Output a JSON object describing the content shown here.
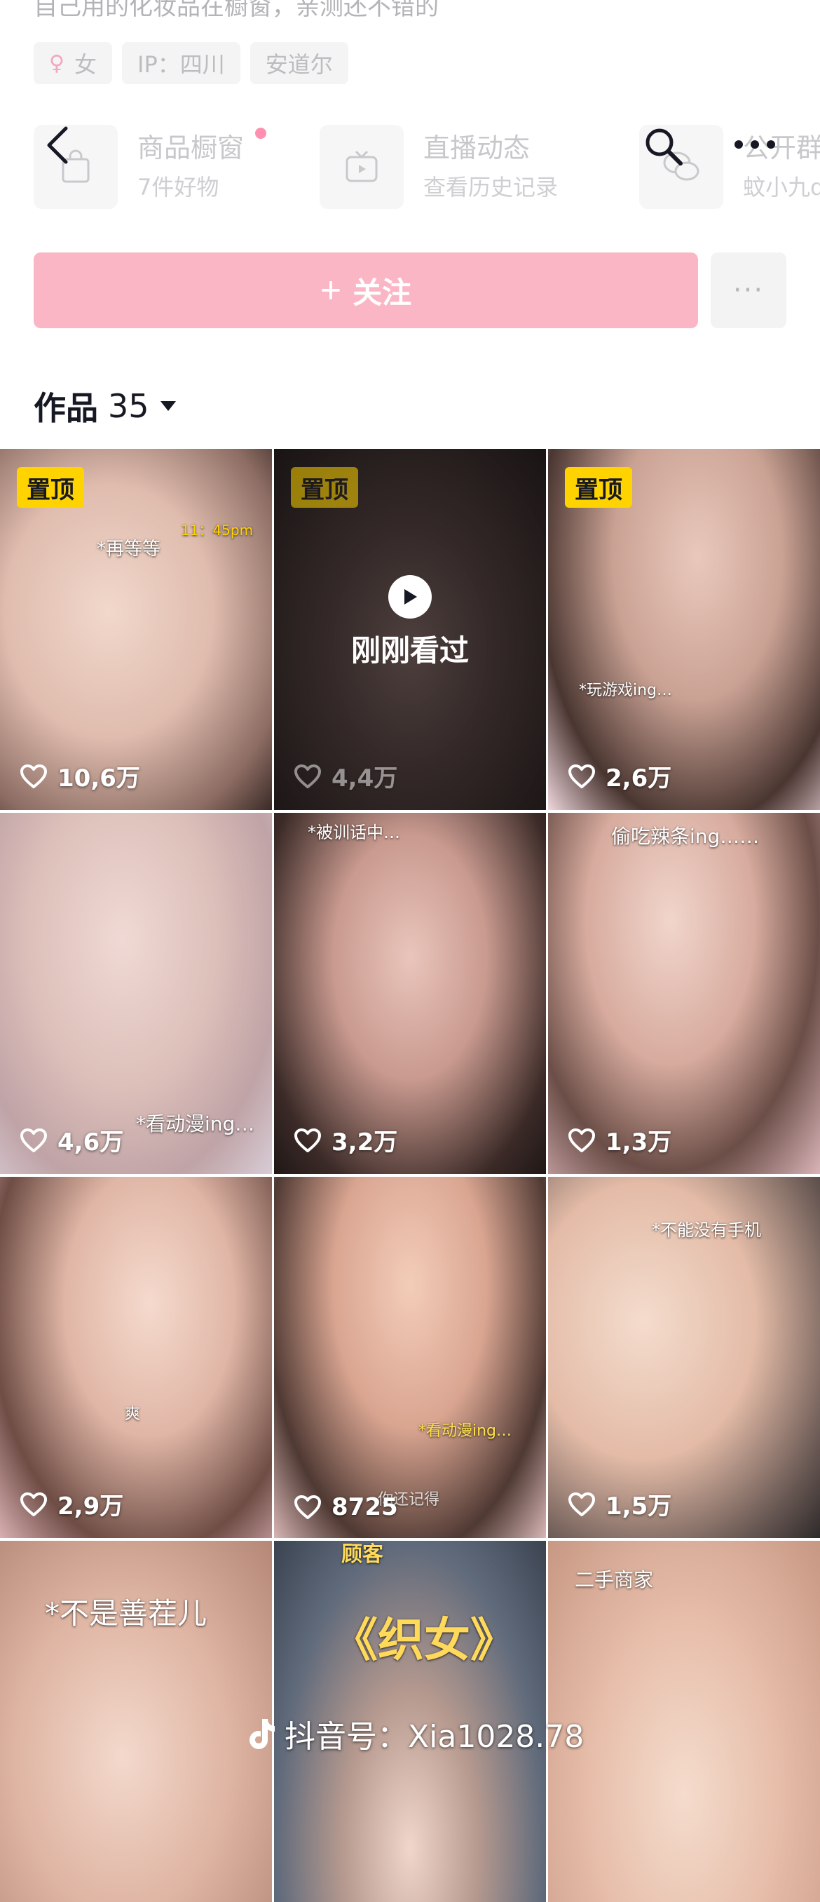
{
  "profile": {
    "bio": "自己用的化妆品在橱窗，亲测还不错的",
    "tags": [
      {
        "label": "女",
        "icon": "female-symbol-icon"
      },
      {
        "label": "IP：四川"
      },
      {
        "label": "安道尔"
      }
    ]
  },
  "cards": {
    "shop": {
      "title": "商品橱窗",
      "subtitle": "7件好物"
    },
    "live": {
      "title": "直播动态",
      "subtitle": "查看历史记录"
    },
    "group": {
      "title": "公开群",
      "subtitle": "蚊小九di"
    }
  },
  "nav": {
    "back_icon": "back-arrow-icon",
    "search_icon": "search-icon",
    "more_icon": "more-dots-icon"
  },
  "follow": {
    "plus": "+",
    "label": "关注",
    "more": "···"
  },
  "works": {
    "label": "作品",
    "count": "35"
  },
  "grid": {
    "tiles": [
      {
        "pinned": "置顶",
        "caption": "*再等等",
        "time": "11：45pm",
        "likes": "10,6万"
      },
      {
        "pinned": "置顶",
        "watched": "刚刚看过",
        "likes": "4,4万"
      },
      {
        "pinned": "置顶",
        "caption": "*玩游戏ing…",
        "likes": "2,6万"
      },
      {
        "caption": "*看动漫ing…",
        "likes": "4,6万"
      },
      {
        "caption": "*被训话中…",
        "likes": "3,2万"
      },
      {
        "caption": "偷吃辣条ing……",
        "likes": "1,3万"
      },
      {
        "caption": "爽",
        "likes": "2,9万"
      },
      {
        "caption": "*看动漫ing…",
        "caption2": "你还记得",
        "likes": "8725"
      },
      {
        "caption": "*不能没有手机",
        "likes": "1,5万"
      },
      {
        "caption": "*不是善茬儿"
      },
      {
        "caption_top": "顾客",
        "title": "《织女》"
      },
      {
        "caption": "二手商家"
      }
    ]
  },
  "watermark": {
    "text": "抖音号：Xia1028.78",
    "icon": "douyin-logo-icon"
  },
  "colors": {
    "accent": "#fbb6c6",
    "badge": "#ffd300",
    "text": "#161823"
  }
}
